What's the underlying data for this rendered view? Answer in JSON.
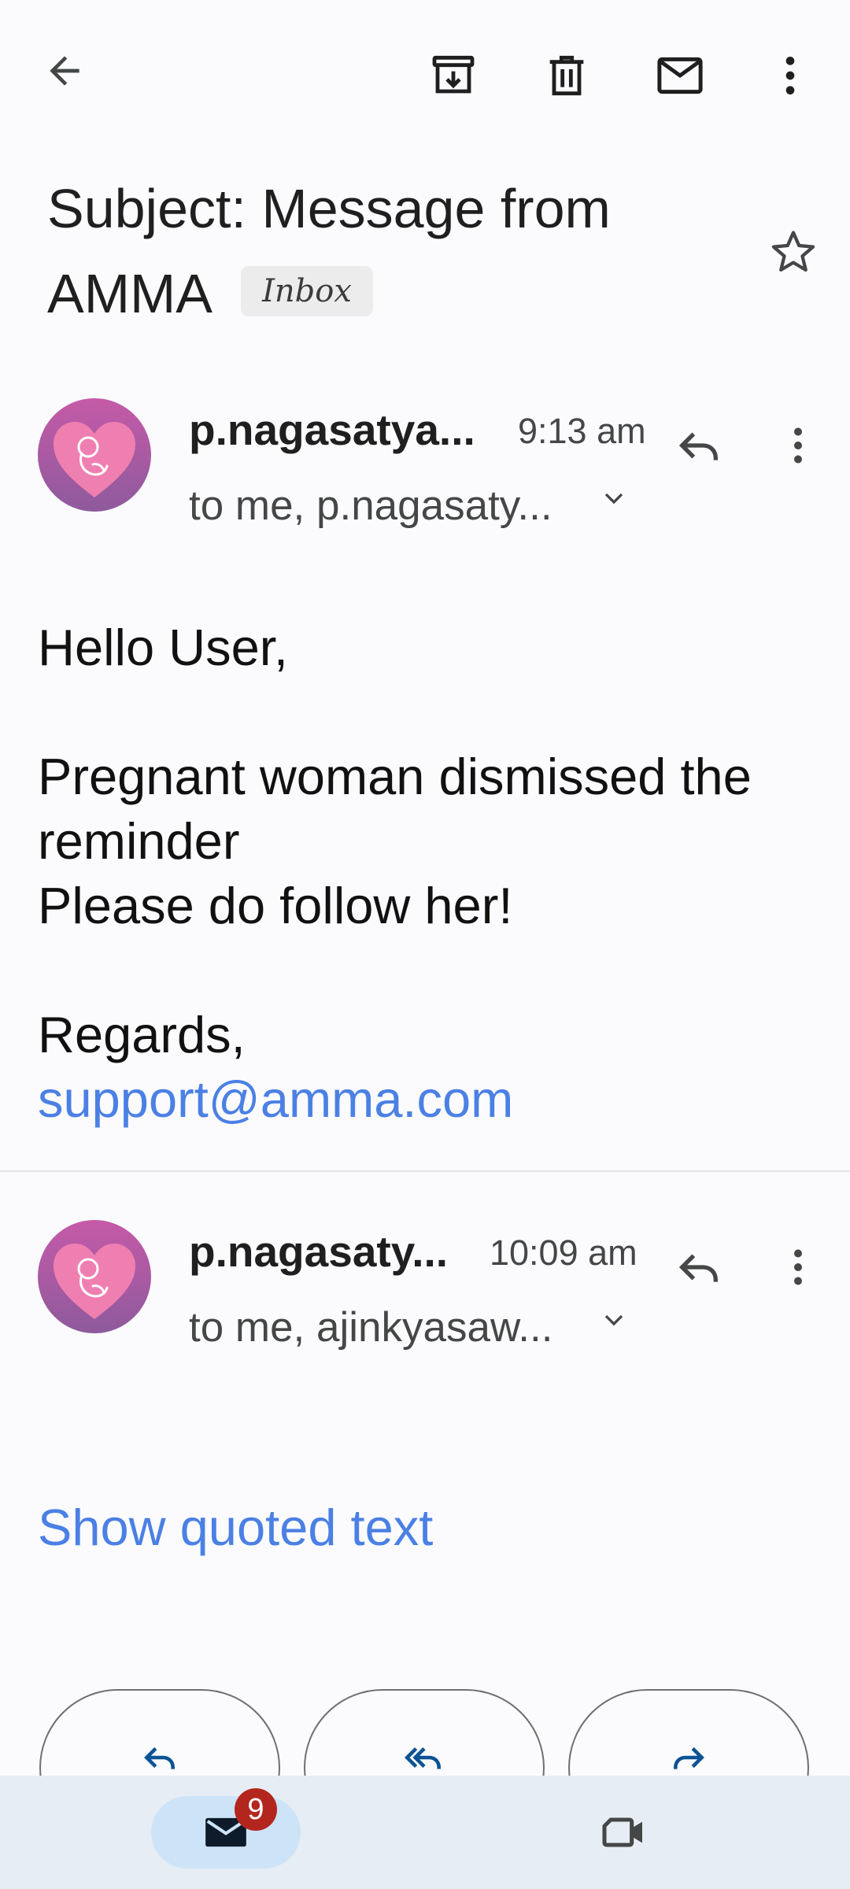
{
  "toolbar": {
    "back_icon": "arrow-back-icon",
    "archive_icon": "archive-icon",
    "delete_icon": "trash-icon",
    "mark_unread_icon": "mail-icon",
    "more_icon": "more-vert-icon"
  },
  "subject": {
    "line1": "Subject: Message from",
    "line2": "AMMA",
    "label_chip": "Inbox",
    "star_icon": "star-outline-icon"
  },
  "messages": [
    {
      "sender": "p.nagasatya...",
      "time": "9:13 am",
      "recipients": "to me, p.nagasaty...",
      "reply_icon": "reply-icon",
      "more_icon": "more-vert-icon"
    },
    {
      "sender": "p.nagasaty...",
      "time": "10:09 am",
      "recipients": "to me, ajinkyasaw...",
      "reply_icon": "reply-icon",
      "more_icon": "more-vert-icon"
    }
  ],
  "body": {
    "greeting": "Hello User,",
    "line1": "Pregnant woman dismissed the",
    "line2": "reminder",
    "line3": "Please do follow her!",
    "regards": "Regards,",
    "email_link": "support@amma.com"
  },
  "show_quoted": "Show quoted text",
  "actions": {
    "reply_icon": "reply-icon",
    "reply_all_icon": "reply-all-icon",
    "forward_icon": "forward-icon"
  },
  "bottom_nav": {
    "mail_icon": "mail-icon",
    "mail_badge": "9",
    "meet_icon": "video-camera-icon"
  },
  "colors": {
    "link": "#4b80e4",
    "badge": "#b3261e",
    "accent_dark": "#0b5394",
    "avatar": "#c55aa8"
  }
}
